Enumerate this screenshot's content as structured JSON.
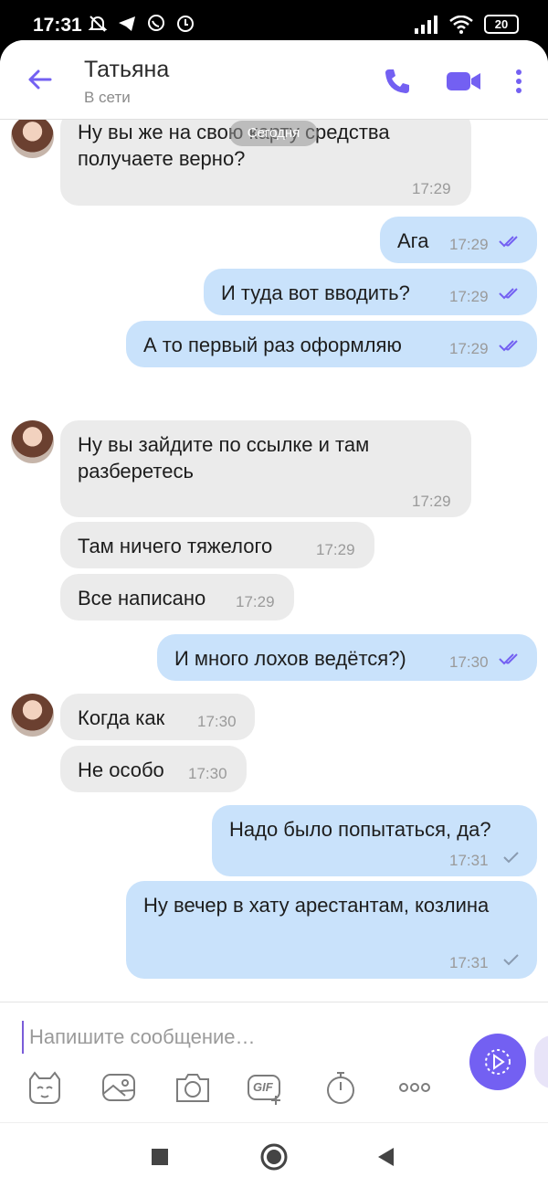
{
  "status_bar": {
    "time": "17:31",
    "battery": "20"
  },
  "header": {
    "contact_name": "Татьяна",
    "status": "В сети"
  },
  "date_separator": "Сегодня",
  "messages": [
    {
      "direction": "in",
      "text": "Ну вы же на свою карту средства получаете верно?",
      "time": "17:29"
    },
    {
      "direction": "out",
      "text": "Ага",
      "time": "17:29",
      "status": "read"
    },
    {
      "direction": "out",
      "text": "И туда вот вводить?",
      "time": "17:29",
      "status": "read"
    },
    {
      "direction": "out",
      "text": "А то первый раз оформляю",
      "time": "17:29",
      "status": "read"
    },
    {
      "direction": "in",
      "text": "Ну вы зайдите по ссылке и там разберетесь",
      "time": "17:29"
    },
    {
      "direction": "in",
      "text": "Там ничего тяжелого",
      "time": "17:29"
    },
    {
      "direction": "in",
      "text": "Все написано",
      "time": "17:29"
    },
    {
      "direction": "out",
      "text": "И много лохов ведётся?)",
      "time": "17:30",
      "status": "read"
    },
    {
      "direction": "in",
      "text": "Когда как",
      "time": "17:30"
    },
    {
      "direction": "in",
      "text": "Не особо",
      "time": "17:30"
    },
    {
      "direction": "out",
      "text": "Надо было попытаться, да?",
      "time": "17:31",
      "status": "delivered"
    },
    {
      "direction": "out",
      "text": "Ну вечер в хату арестантам, козлина",
      "time": "17:31",
      "status": "delivered"
    }
  ],
  "compose": {
    "placeholder": "Напишите сообщение…",
    "gif_label": "GIF"
  },
  "colors": {
    "accent": "#7360f2",
    "incoming_bubble": "#ebebeb",
    "outgoing_bubble": "#c9e2fb"
  }
}
